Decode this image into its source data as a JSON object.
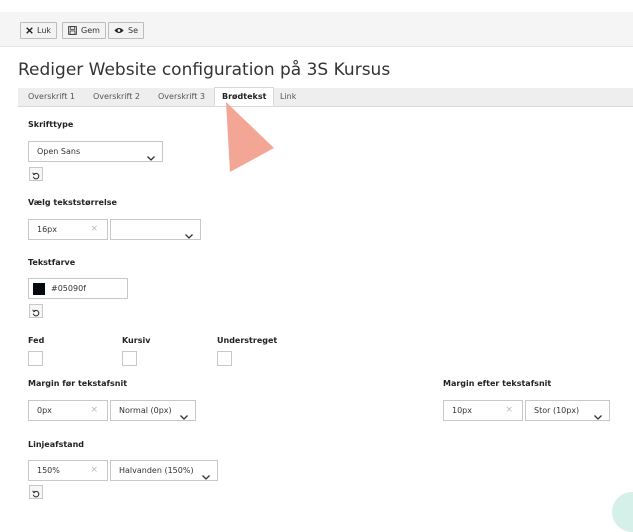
{
  "toolbar": {
    "close_label": "Luk",
    "save_label": "Gem",
    "view_label": "Se"
  },
  "page": {
    "title": "Rediger Website configuration på 3S Kursus"
  },
  "tabs": [
    {
      "label": "Overskrift 1",
      "active": false
    },
    {
      "label": "Overskrift 2",
      "active": false
    },
    {
      "label": "Overskrift 3",
      "active": false
    },
    {
      "label": "Brødtekst",
      "active": true
    },
    {
      "label": "Link",
      "active": false
    }
  ],
  "form": {
    "font": {
      "label": "Skrifttype",
      "value": "Open Sans"
    },
    "size": {
      "label": "Vælg tekststørrelse",
      "value": "16px",
      "preset": ""
    },
    "color": {
      "label": "Tekstfarve",
      "value": "#05090f",
      "swatch": "#05090f"
    },
    "bold": {
      "label": "Fed",
      "checked": false
    },
    "italic": {
      "label": "Kursiv",
      "checked": false
    },
    "underline": {
      "label": "Understreget",
      "checked": false
    },
    "margin_before": {
      "label": "Margin før tekstafsnit",
      "value": "0px",
      "preset": "Normal (0px)"
    },
    "margin_after": {
      "label": "Margin efter tekstafsnit",
      "value": "10px",
      "preset": "Stor (10px)"
    },
    "line_height": {
      "label": "Linjeafstand",
      "value": "150%",
      "preset": "Halvanden (150%)"
    }
  },
  "colors": {
    "pointer": "#f3a596",
    "corner_badge": "#d5efe9"
  }
}
